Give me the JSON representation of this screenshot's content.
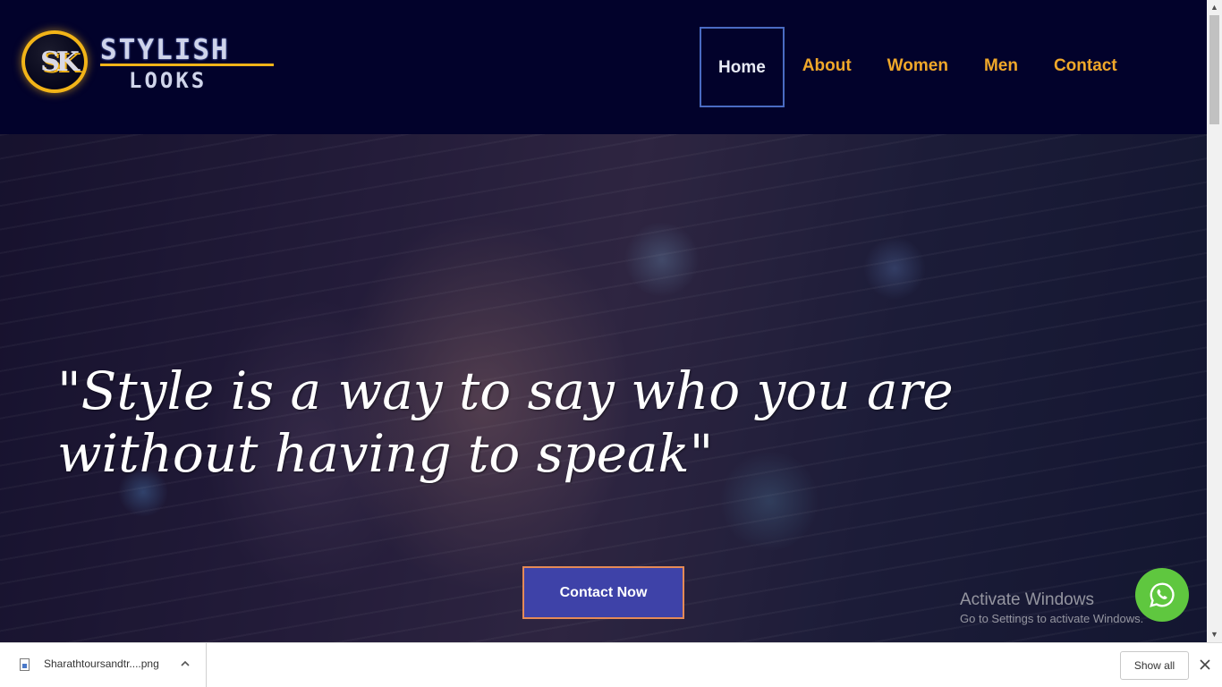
{
  "header": {
    "logo": {
      "monogram": "SK",
      "word_top": "STYLISH",
      "word_bottom": "LOOKS"
    },
    "nav": [
      {
        "label": "Home",
        "active": true
      },
      {
        "label": "About"
      },
      {
        "label": "Women"
      },
      {
        "label": "Men"
      },
      {
        "label": "Contact"
      }
    ]
  },
  "hero": {
    "quote": "\"Style is a way to say who you are without having to speak\"",
    "cta_label": "Contact Now"
  },
  "watermark": {
    "title": "Activate Windows",
    "subtitle": "Go to Settings to activate Windows."
  },
  "downloads_bar": {
    "file_name": "Sharathtoursandtr....png",
    "show_all_label": "Show all"
  },
  "icons": {
    "whatsapp": "whatsapp-icon",
    "file": "image-file-icon",
    "chevron": "chevron-up-icon",
    "close": "close-icon"
  },
  "colors": {
    "header_bg": "#02022b",
    "nav_text": "#f0a82a",
    "nav_active_border": "#4a6bc2",
    "cta_bg": "#3e42a8",
    "cta_border": "#e58a57",
    "whatsapp_green": "#5fc73f",
    "logo_gold": "#f2b418"
  }
}
